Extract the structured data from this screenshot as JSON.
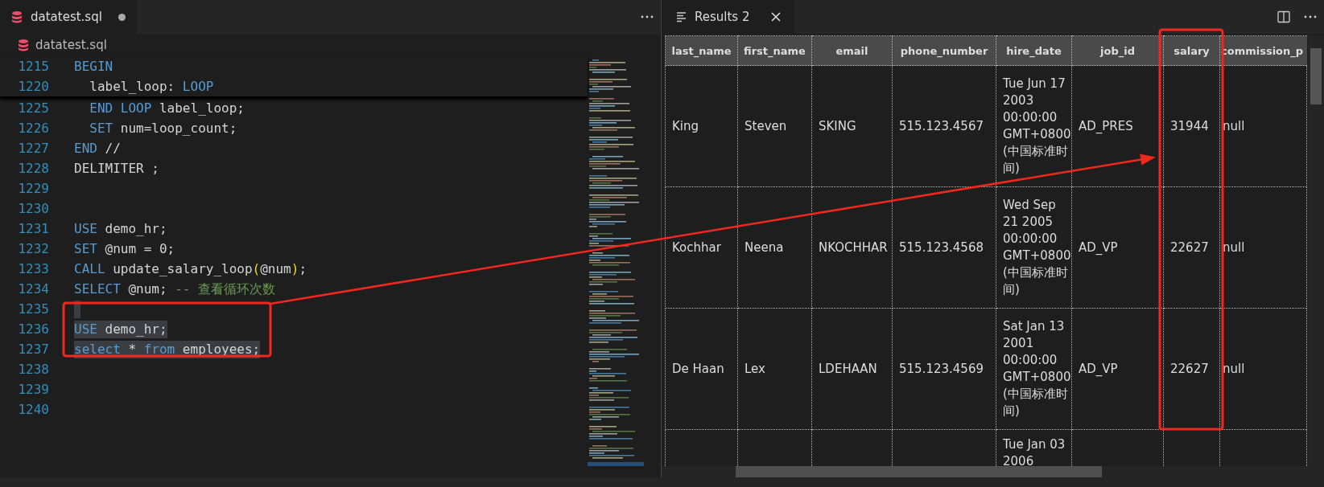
{
  "editor": {
    "tab": {
      "title": "datatest.sql",
      "modified": true,
      "selected": true
    },
    "breadcrumb": "datatest.sql",
    "sticky_lines": [
      {
        "number": "1215",
        "tokens": [
          {
            "kind": "keyword",
            "text": "BEGIN"
          }
        ]
      },
      {
        "number": "1220",
        "tokens": [
          {
            "kind": "text",
            "text": "  label_loop: "
          },
          {
            "kind": "keyword",
            "text": "LOOP"
          }
        ]
      }
    ],
    "lines": [
      {
        "number": "1225",
        "selected": false,
        "tokens": [
          {
            "kind": "keyword",
            "text": "  END LOOP"
          },
          {
            "kind": "text",
            "text": " label_loop;"
          }
        ]
      },
      {
        "number": "1226",
        "selected": false,
        "tokens": [
          {
            "kind": "keyword",
            "text": "  SET"
          },
          {
            "kind": "text",
            "text": " num=loop_count;"
          }
        ]
      },
      {
        "number": "1227",
        "selected": false,
        "tokens": [
          {
            "kind": "keyword",
            "text": "END"
          },
          {
            "kind": "text",
            "text": " //"
          }
        ]
      },
      {
        "number": "1228",
        "selected": false,
        "tokens": [
          {
            "kind": "text",
            "text": "DELIMITER ;"
          }
        ]
      },
      {
        "number": "1229",
        "selected": false
      },
      {
        "number": "1230",
        "selected": false
      },
      {
        "number": "1231",
        "selected": false,
        "tokens": [
          {
            "kind": "keyword",
            "text": "USE"
          },
          {
            "kind": "text",
            "text": " demo_hr;"
          }
        ]
      },
      {
        "number": "1232",
        "selected": false,
        "tokens": [
          {
            "kind": "keyword",
            "text": "SET"
          },
          {
            "kind": "text",
            "text": " @num = 0;"
          }
        ]
      },
      {
        "number": "1233",
        "selected": false,
        "tokens": [
          {
            "kind": "keyword",
            "text": "CALL"
          },
          {
            "kind": "text",
            "text": " update_salary_loop"
          },
          {
            "kind": "bracket",
            "text": "("
          },
          {
            "kind": "text",
            "text": "@num"
          },
          {
            "kind": "bracket",
            "text": ")"
          },
          {
            "kind": "text",
            "text": ";"
          }
        ]
      },
      {
        "number": "1234",
        "selected": false,
        "tokens": [
          {
            "kind": "keyword",
            "text": "SELECT"
          },
          {
            "kind": "text",
            "text": " @num; "
          },
          {
            "kind": "comment",
            "text": "-- 查看循环次数"
          }
        ]
      },
      {
        "number": "1235",
        "selected": true
      },
      {
        "number": "1236",
        "selected": true,
        "tokens": [
          {
            "kind": "keyword",
            "text": "USE"
          },
          {
            "kind": "text",
            "text": " demo_hr;"
          }
        ]
      },
      {
        "number": "1237",
        "selected": true,
        "tokens": [
          {
            "kind": "keyword",
            "text": "select"
          },
          {
            "kind": "text",
            "text": " * "
          },
          {
            "kind": "keyword",
            "text": "from"
          },
          {
            "kind": "text",
            "text": " employees;"
          }
        ]
      },
      {
        "number": "1238",
        "selected": false
      },
      {
        "number": "1239",
        "selected": false
      },
      {
        "number": "1240",
        "selected": false
      }
    ]
  },
  "results": {
    "tab": {
      "title": "Results 2",
      "selected": true
    },
    "table": {
      "columns": [
        "last_name",
        "first_name",
        "email",
        "phone_number",
        "hire_date",
        "job_id",
        "salary",
        "commission_p"
      ],
      "rows": [
        {
          "cells": [
            "King",
            "Steven",
            "SKING",
            "515.123.4567",
            "Tue Jun 17 2003 00:00:00 GMT+0800 (中国标准时间)",
            "AD_PRES",
            "31944",
            "null"
          ]
        },
        {
          "cells": [
            "Kochhar",
            "Neena",
            "NKOCHHAR",
            "515.123.4568",
            "Wed Sep 21 2005 00:00:00 GMT+0800 (中国标准时间)",
            "AD_VP",
            "22627",
            "null"
          ]
        },
        {
          "cells": [
            "De Haan",
            "Lex",
            "LDEHAAN",
            "515.123.4569",
            "Sat Jan 13 2001 00:00:00 GMT+0800 (中国标准时间)",
            "AD_VP",
            "22627",
            "null"
          ]
        },
        {
          "cells": [
            null,
            null,
            null,
            null,
            "Tue Jan 03 2006",
            null,
            null,
            null
          ]
        }
      ]
    }
  }
}
